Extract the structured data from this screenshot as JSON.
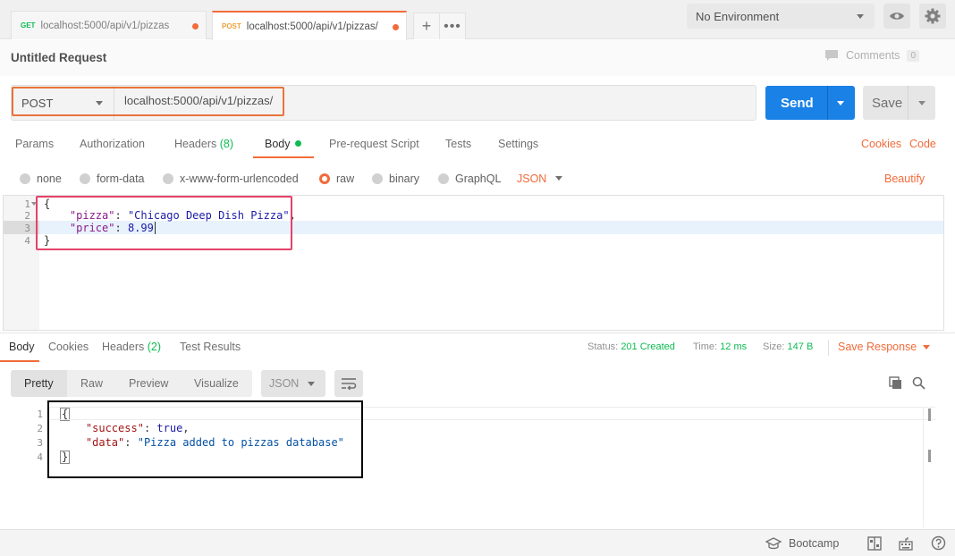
{
  "tabs": [
    {
      "method": "GET",
      "url": "localhost:5000/api/v1/pizzas"
    },
    {
      "method": "POST",
      "url": "localhost:5000/api/v1/pizzas/"
    }
  ],
  "environment": "No Environment",
  "request": {
    "title": "Untitled Request",
    "comments_label": "Comments",
    "comments_count": "0",
    "method": "POST",
    "url": "localhost:5000/api/v1/pizzas/",
    "send_label": "Send",
    "save_label": "Save"
  },
  "request_tabs": {
    "params": "Params",
    "authorization": "Authorization",
    "headers": "Headers",
    "headers_count": "(8)",
    "body": "Body",
    "pre_request": "Pre-request Script",
    "tests": "Tests",
    "settings": "Settings",
    "cookies": "Cookies",
    "code": "Code"
  },
  "body_types": {
    "none": "none",
    "form_data": "form-data",
    "urlencoded": "x-www-form-urlencoded",
    "raw": "raw",
    "binary": "binary",
    "graphql": "GraphQL",
    "format": "JSON",
    "beautify": "Beautify"
  },
  "request_body": {
    "line_numbers": [
      "1",
      "2",
      "3",
      "4"
    ],
    "open": "{",
    "pizza_key": "\"pizza\"",
    "pizza_value": "\"Chicago Deep Dish Pizza\"",
    "price_key": "\"price\"",
    "price_value": "8.99",
    "close": "}"
  },
  "response_tabs": {
    "body": "Body",
    "cookies": "Cookies",
    "headers": "Headers",
    "headers_count": "(2)",
    "test_results": "Test Results"
  },
  "response_status": {
    "status_label": "Status:",
    "status_value": "201 Created",
    "time_label": "Time:",
    "time_value": "12 ms",
    "size_label": "Size:",
    "size_value": "147 B",
    "save_response": "Save Response"
  },
  "response_views": {
    "pretty": "Pretty",
    "raw": "Raw",
    "preview": "Preview",
    "visualize": "Visualize",
    "format": "JSON"
  },
  "response_body": {
    "line_numbers": [
      "1",
      "2",
      "3",
      "4"
    ],
    "open": "{",
    "success_key": "\"success\"",
    "success_value": "true",
    "data_key": "\"data\"",
    "data_value": "\"Pizza added to pizzas database\"",
    "close": "}"
  },
  "footer": {
    "bootcamp": "Bootcamp"
  },
  "colors": {
    "accent": "#f26b3a",
    "send": "#1a81e6",
    "success": "#0cbb52",
    "highlight_url": "#e8743b",
    "highlight_body": "#e5436a",
    "highlight_response": "#000000"
  },
  "icons": [
    "eye-icon",
    "gear-icon",
    "plus-icon",
    "more-icon",
    "comment-icon",
    "copy-icon",
    "search-icon",
    "wrap-icon",
    "bootcamp-icon",
    "layout-icon",
    "keyboard-icon",
    "help-icon"
  ]
}
